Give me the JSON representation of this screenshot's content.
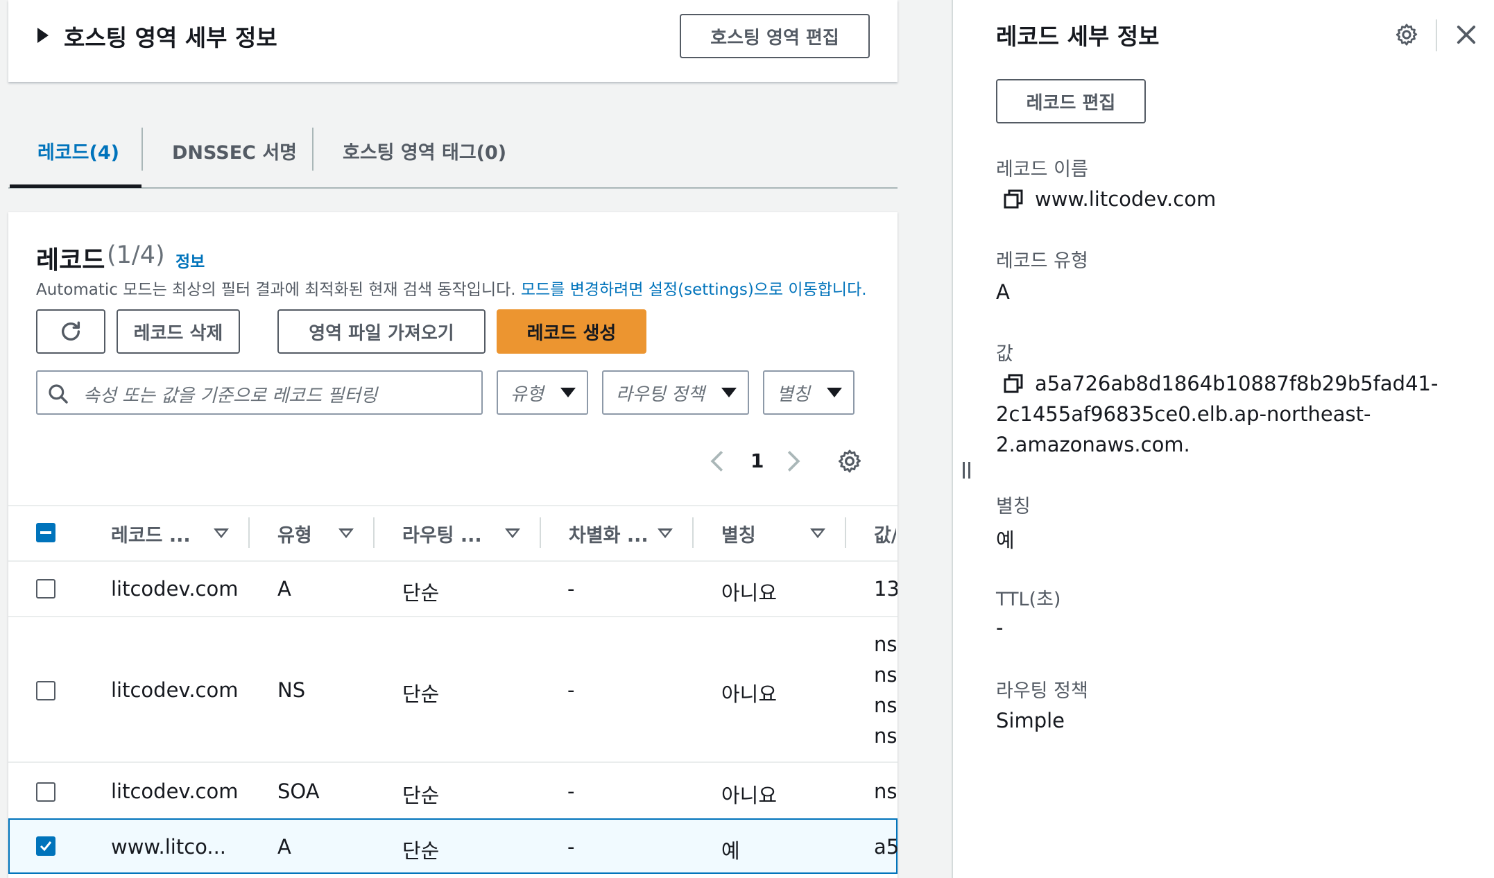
{
  "hosted_zone": {
    "section_title": "호스팅 영역 세부 정보",
    "edit_button": "호스팅 영역 편집"
  },
  "tabs": [
    {
      "label": "레코드(4)",
      "active": true
    },
    {
      "label": "DNSSEC 서명",
      "active": false
    },
    {
      "label": "호스팅 영역 태그(0)",
      "active": false
    }
  ],
  "records_panel": {
    "title": "레코드",
    "count": "(1/4)",
    "info_link": "정보",
    "description": "Automatic 모드는 최상의 필터 결과에 최적화된 현재 검색 동작입니다.",
    "description_link": "모드를 변경하려면 설정(settings)으로 이동합니다.",
    "buttons": {
      "delete": "레코드 삭제",
      "import": "영역 파일 가져오기",
      "create": "레코드 생성"
    },
    "search_placeholder": "속성 또는 값을 기준으로 레코드 필터링",
    "filters": {
      "type": "유형",
      "routing": "라우팅 정책",
      "alias": "별칭"
    },
    "pagination": {
      "page": "1"
    },
    "columns": [
      "레코드 ...",
      "유형",
      "라우팅 ...",
      "차별화 ...",
      "별칭",
      "값/"
    ],
    "rows": [
      {
        "name": "litcodev.com",
        "type": "A",
        "routing": "단순",
        "diff": "-",
        "alias": "아니요",
        "value": [
          "13"
        ],
        "checked": false
      },
      {
        "name": "litcodev.com",
        "type": "NS",
        "routing": "단순",
        "diff": "-",
        "alias": "아니요",
        "value": [
          "ns-",
          "ns-",
          "ns-",
          "ns-"
        ],
        "checked": false
      },
      {
        "name": "litcodev.com",
        "type": "SOA",
        "routing": "단순",
        "diff": "-",
        "alias": "아니요",
        "value": [
          "ns-"
        ],
        "checked": false
      },
      {
        "name": "www.litco...",
        "type": "A",
        "routing": "단순",
        "diff": "-",
        "alias": "예",
        "value": [
          "a5"
        ],
        "checked": true
      }
    ]
  },
  "detail_panel": {
    "title": "레코드 세부 정보",
    "edit_button": "레코드 편집",
    "fields": {
      "name_label": "레코드 이름",
      "name_value": "www.litcodev.com",
      "type_label": "레코드 유형",
      "type_value": "A",
      "value_label": "값",
      "value_lines": [
        "a5a726ab8d1864b10887f8b29b5fad41-",
        "2c1455af96835ce0.elb.ap-northeast-",
        "2.amazonaws.com."
      ],
      "alias_label": "별칭",
      "alias_value": "예",
      "ttl_label": "TTL(초)",
      "ttl_value": "-",
      "routing_label": "라우팅 정책",
      "routing_value": "Simple"
    }
  },
  "colors": {
    "accent": "#0073bb",
    "primary_button": "#ec9530",
    "selected_row_bg": "#f1faff"
  }
}
